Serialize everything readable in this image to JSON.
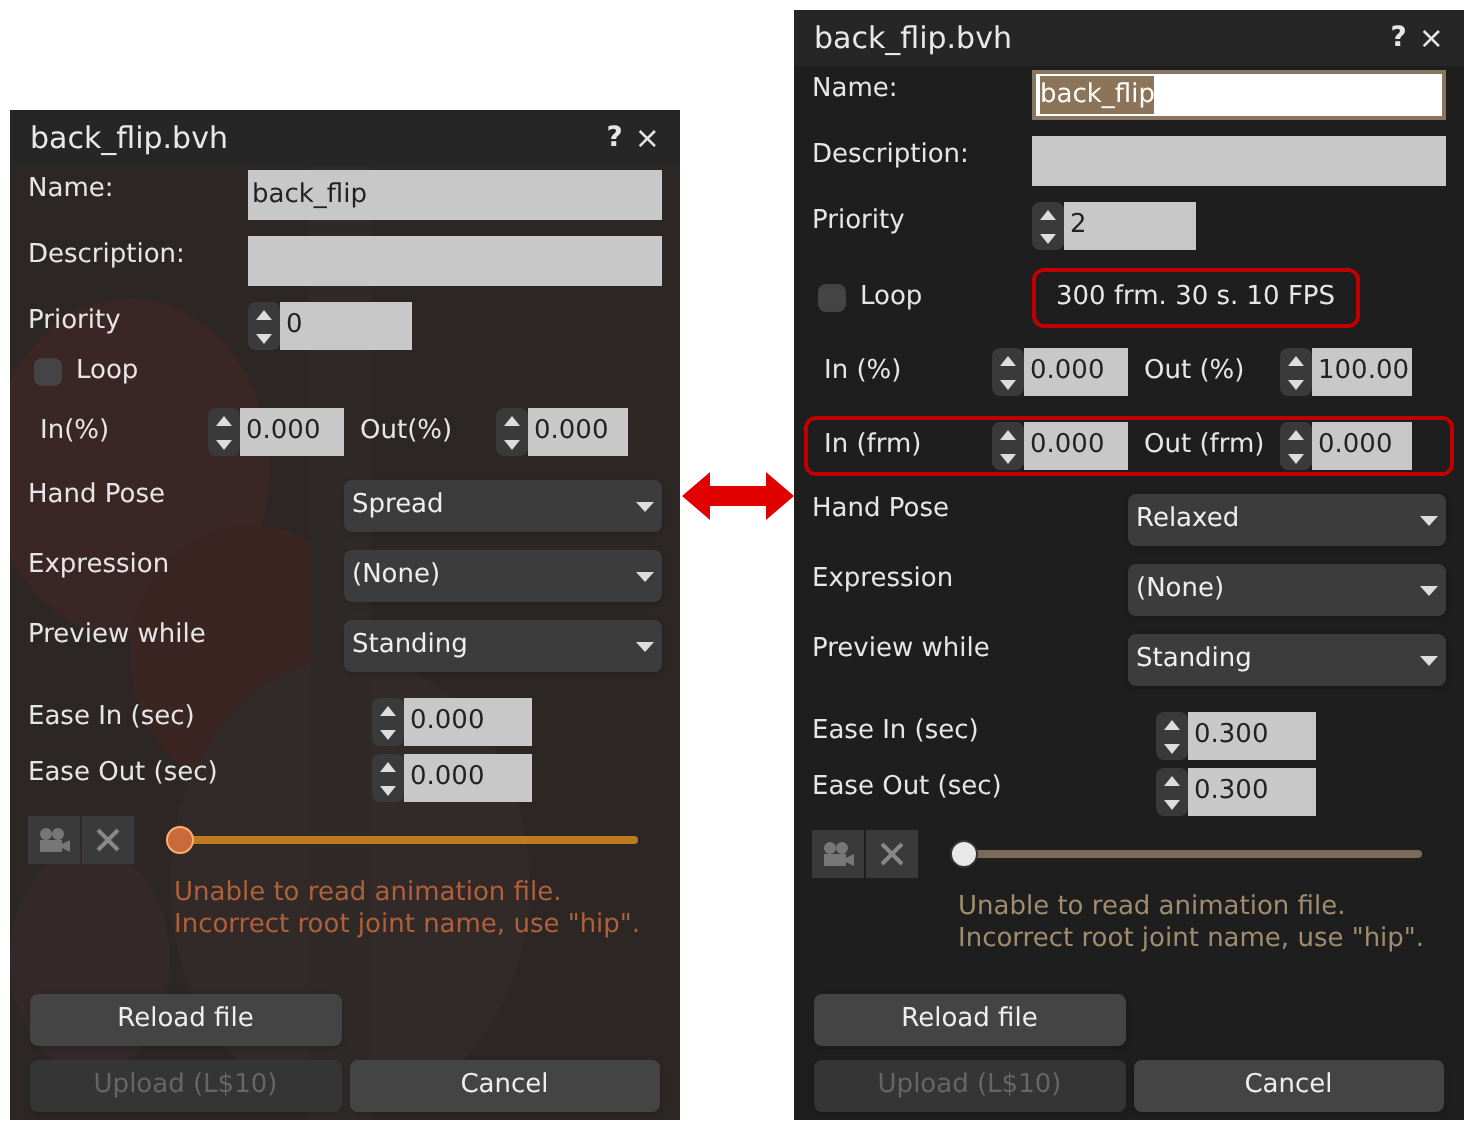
{
  "panels": [
    {
      "kind": "old",
      "title": "back_flip.bvh",
      "help": "?",
      "close": "×",
      "name": {
        "label": "Name:",
        "value": "back_flip",
        "selected": false
      },
      "description": {
        "label": "Description:"
      },
      "priority": {
        "label": "Priority",
        "value": "0"
      },
      "loop": {
        "label": "Loop",
        "checked": false
      },
      "ranges": [
        {
          "highlighted": false,
          "fields": [
            {
              "label": "In(%)",
              "value": "0.000"
            },
            {
              "label": "Out(%)",
              "value": "0.000"
            }
          ]
        }
      ],
      "dropdowns": [
        {
          "label": "Hand Pose",
          "value": "Spread"
        },
        {
          "label": "Expression",
          "value": "(None)"
        },
        {
          "label": "Preview while",
          "value": "Standing"
        }
      ],
      "ease": [
        {
          "label": "Ease In (sec)",
          "value": "0.000"
        },
        {
          "label": "Ease Out (sec)",
          "value": "0.000"
        }
      ],
      "slider": {
        "level": 0
      },
      "error_lines": [
        "Unable to read animation file.",
        "Incorrect root joint name, use \"hip\"."
      ],
      "buttons": [
        {
          "label": "Reload file",
          "disabled": false
        },
        {
          "label": "Upload (L$10)",
          "disabled": true
        },
        {
          "label": "Cancel",
          "disabled": false
        }
      ]
    },
    {
      "kind": "new",
      "title": "back_flip.bvh",
      "help": "?",
      "close": "×",
      "name": {
        "label": "Name:",
        "value": "back_flip",
        "selected": true
      },
      "description": {
        "label": "Description:"
      },
      "priority": {
        "label": "Priority",
        "value": "2"
      },
      "loop": {
        "label": "Loop",
        "checked": false
      },
      "info": {
        "text": "300 frm. 30 s. 10 FPS",
        "highlighted": true
      },
      "ranges": [
        {
          "highlighted": false,
          "fields": [
            {
              "label": "In (%)",
              "value": "0.000"
            },
            {
              "label": "Out (%)",
              "value": "100.00"
            }
          ]
        },
        {
          "highlighted": true,
          "fields": [
            {
              "label": "In (frm)",
              "value": "0.000"
            },
            {
              "label": "Out (frm)",
              "value": "0.000"
            }
          ]
        }
      ],
      "dropdowns": [
        {
          "label": "Hand Pose",
          "value": "Relaxed"
        },
        {
          "label": "Expression",
          "value": "(None)"
        },
        {
          "label": "Preview while",
          "value": "Standing"
        }
      ],
      "ease": [
        {
          "label": "Ease In (sec)",
          "value": "0.300"
        },
        {
          "label": "Ease Out (sec)",
          "value": "0.300"
        }
      ],
      "slider": {
        "level": 0
      },
      "error_lines": [
        "Unable to read animation file.",
        "Incorrect root joint name, use \"hip\"."
      ],
      "buttons": [
        {
          "label": "Reload file",
          "disabled": false
        },
        {
          "label": "Upload (L$10)",
          "disabled": true
        },
        {
          "label": "Cancel",
          "disabled": false
        }
      ]
    }
  ]
}
